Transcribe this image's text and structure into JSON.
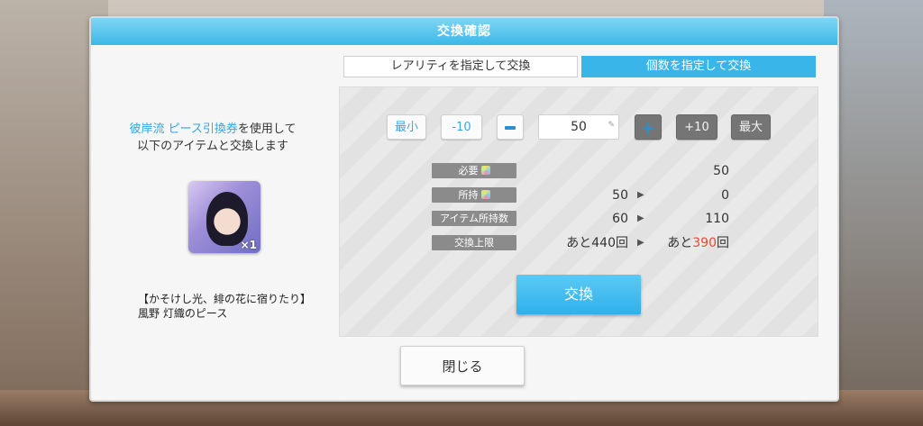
{
  "title": "交換確認",
  "tabs": [
    {
      "label": "レアリティを指定して交換",
      "active": false
    },
    {
      "label": "個数を指定して交換",
      "active": true
    }
  ],
  "left": {
    "ticket_name": "彼岸流 ピース引換券",
    "desc_suffix": "を使用して",
    "desc_line2": "以下のアイテムと交換します",
    "item_count": "×1",
    "item_name_line1": "【かそけし光、緋の花に宿りたり】",
    "item_name_line2": "風野 灯織のピース"
  },
  "controls": {
    "min_label": "最小",
    "minus10_label": "-10",
    "plus10_label": "+10",
    "max_label": "最大",
    "quantity": "50"
  },
  "rows": [
    {
      "label": "必要",
      "current": "",
      "after": "50"
    },
    {
      "label": "所持",
      "current": "50",
      "after": "0"
    },
    {
      "label": "アイテム所持数",
      "current": "60",
      "after": "110"
    },
    {
      "label": "交換上限",
      "current": "あと440回",
      "after_prefix": "あと",
      "after_number": "390",
      "after_suffix": "回"
    }
  ],
  "exchange_label": "交換",
  "close_label": "閉じる",
  "colors": {
    "accent": "#39b5ea",
    "warn": "#f2462f"
  }
}
